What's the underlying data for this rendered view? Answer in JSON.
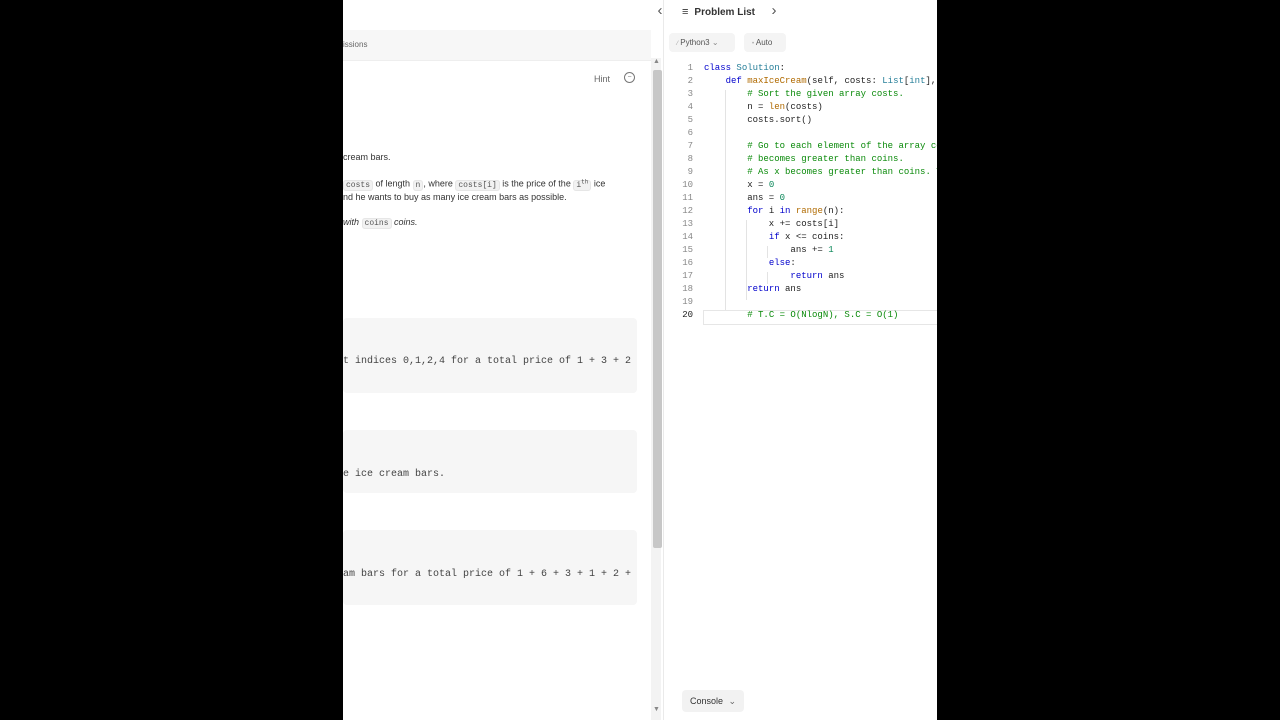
{
  "topbar": {
    "prev_icon": "‹",
    "next_icon": "›",
    "list_icon": "≡",
    "problem_list_label": "Problem List"
  },
  "left": {
    "tab_partial": "issions",
    "hint_label": "Hint",
    "desc_line1": "cream bars.",
    "desc_line2_a": "costs",
    "desc_line2_b": " of length ",
    "desc_line2_c": "n",
    "desc_line2_d": ", where ",
    "desc_line2_e": "costs[i]",
    "desc_line2_f": " is the price of the ",
    "desc_line2_g": "i",
    "desc_line2_sup": "th",
    "desc_line2_h": " ice",
    "desc_line3": "nd he wants to buy as many ice cream bars as possible.",
    "desc_line4_a": "with ",
    "desc_line4_b": "coins",
    "desc_line4_c": " coins.",
    "example1_text": "t indices 0,1,2,4 for a total price of 1 + 3 + 2",
    "example2_text": "e ice cream bars.",
    "example3_text": "am bars for a total price of 1 + 6 + 3 + 1 + 2 +"
  },
  "editor": {
    "language": "Python3",
    "auto_label": "Auto",
    "console_label": "Console",
    "line_numbers": [
      "1",
      "2",
      "3",
      "4",
      "5",
      "6",
      "7",
      "8",
      "9",
      "10",
      "11",
      "12",
      "13",
      "14",
      "15",
      "16",
      "17",
      "18",
      "19",
      "20"
    ]
  }
}
